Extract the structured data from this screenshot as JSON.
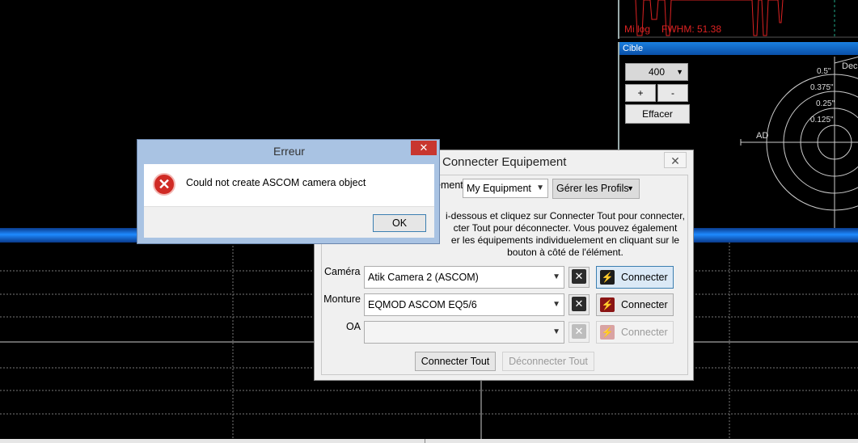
{
  "background": {
    "graph": {
      "fwhm_prefix": "Mi log",
      "fwhm_label": "FWHM: 51.38"
    },
    "cible_panel": {
      "title": "Cible",
      "zoom_value": "400",
      "plus_label": "+",
      "minus_label": "-",
      "clear_label": "Effacer",
      "dec_label": "Dec",
      "ad_label": "AD",
      "ring_labels": [
        "0.5\"",
        "0.375\"",
        "0.25\"",
        "0.125\""
      ]
    }
  },
  "connect_dialog": {
    "title": "Connecter Equipement",
    "close_icon": "close-icon",
    "profile_label_visible": "ement",
    "profile_value": "My Equipment",
    "manage_profiles_label": "Gérer les Profils",
    "description_lines": [
      "i-dessous et cliquez sur Connecter Tout pour connecter,",
      "cter Tout pour déconnecter. Vous pouvez également",
      "er les équipements individuelement en cliquant sur le",
      "bouton à côté de l'élément."
    ],
    "rows": [
      {
        "label": "Caméra",
        "value": "Atik Camera 2 (ASCOM)",
        "connect_label": "Connecter",
        "state": "selected"
      },
      {
        "label": "Monture",
        "value": "EQMOD ASCOM EQ5/6",
        "connect_label": "Connecter",
        "state": "enabled"
      },
      {
        "label": "OA",
        "value": "",
        "connect_label": "Connecter",
        "state": "disabled"
      }
    ],
    "connect_all_label": "Connecter Tout",
    "disconnect_all_label": "Déconnecter Tout"
  },
  "error_dialog": {
    "title": "Erreur",
    "message": "Could not create ASCOM camera object",
    "ok_label": "OK",
    "close_glyph": "✕"
  },
  "colors": {
    "accent_blue": "#1e8aff",
    "error_red": "#d02b25",
    "graph_red": "#d22"
  }
}
